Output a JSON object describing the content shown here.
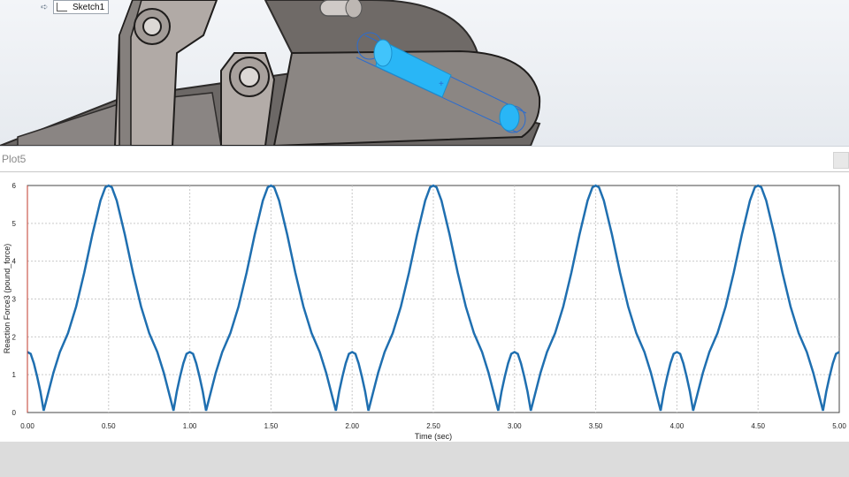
{
  "feature_tree": {
    "item_label": "Sketch1"
  },
  "plot": {
    "title": "Plot5",
    "close_icon": "close-icon"
  },
  "chart_data": {
    "type": "line",
    "xlabel": "Time (sec)",
    "ylabel": "Reaction Force3 (pound_force)",
    "xlim": [
      0,
      5
    ],
    "ylim": [
      0,
      6
    ],
    "grid": true,
    "series_color": "#1f6fb0",
    "x_ticks": [
      "0.00",
      "0.50",
      "1.00",
      "1.50",
      "2.00",
      "2.50",
      "3.00",
      "3.50",
      "4.00",
      "4.50",
      "5.00"
    ],
    "y_ticks": [
      "0",
      "1",
      "2",
      "3",
      "4",
      "5",
      "6"
    ],
    "series": [
      {
        "values": [
          [
            0.0,
            1.6
          ],
          [
            0.02,
            1.55
          ],
          [
            0.04,
            1.3
          ],
          [
            0.06,
            0.95
          ],
          [
            0.08,
            0.55
          ],
          [
            0.1,
            0.05
          ],
          [
            0.13,
            0.55
          ],
          [
            0.16,
            1.05
          ],
          [
            0.2,
            1.6
          ],
          [
            0.25,
            2.1
          ],
          [
            0.3,
            2.8
          ],
          [
            0.35,
            3.7
          ],
          [
            0.4,
            4.7
          ],
          [
            0.45,
            5.6
          ],
          [
            0.48,
            5.95
          ],
          [
            0.5,
            6.0
          ],
          [
            0.52,
            5.95
          ],
          [
            0.55,
            5.6
          ],
          [
            0.6,
            4.7
          ],
          [
            0.65,
            3.7
          ],
          [
            0.7,
            2.8
          ],
          [
            0.75,
            2.1
          ],
          [
            0.8,
            1.6
          ],
          [
            0.84,
            1.05
          ],
          [
            0.87,
            0.55
          ],
          [
            0.9,
            0.05
          ],
          [
            0.92,
            0.55
          ],
          [
            0.94,
            0.95
          ],
          [
            0.96,
            1.3
          ],
          [
            0.98,
            1.55
          ],
          [
            1.0,
            1.6
          ],
          [
            1.02,
            1.55
          ],
          [
            1.04,
            1.3
          ],
          [
            1.06,
            0.95
          ],
          [
            1.08,
            0.55
          ],
          [
            1.1,
            0.05
          ],
          [
            1.13,
            0.55
          ],
          [
            1.16,
            1.05
          ],
          [
            1.2,
            1.6
          ],
          [
            1.25,
            2.1
          ],
          [
            1.3,
            2.8
          ],
          [
            1.35,
            3.7
          ],
          [
            1.4,
            4.7
          ],
          [
            1.45,
            5.6
          ],
          [
            1.48,
            5.95
          ],
          [
            1.5,
            6.0
          ],
          [
            1.52,
            5.95
          ],
          [
            1.55,
            5.6
          ],
          [
            1.6,
            4.7
          ],
          [
            1.65,
            3.7
          ],
          [
            1.7,
            2.8
          ],
          [
            1.75,
            2.1
          ],
          [
            1.8,
            1.6
          ],
          [
            1.84,
            1.05
          ],
          [
            1.87,
            0.55
          ],
          [
            1.9,
            0.05
          ],
          [
            1.92,
            0.55
          ],
          [
            1.94,
            0.95
          ],
          [
            1.96,
            1.3
          ],
          [
            1.98,
            1.55
          ],
          [
            2.0,
            1.6
          ],
          [
            2.02,
            1.55
          ],
          [
            2.04,
            1.3
          ],
          [
            2.06,
            0.95
          ],
          [
            2.08,
            0.55
          ],
          [
            2.1,
            0.05
          ],
          [
            2.13,
            0.55
          ],
          [
            2.16,
            1.05
          ],
          [
            2.2,
            1.6
          ],
          [
            2.25,
            2.1
          ],
          [
            2.3,
            2.8
          ],
          [
            2.35,
            3.7
          ],
          [
            2.4,
            4.7
          ],
          [
            2.45,
            5.6
          ],
          [
            2.48,
            5.95
          ],
          [
            2.5,
            6.0
          ],
          [
            2.52,
            5.95
          ],
          [
            2.55,
            5.6
          ],
          [
            2.6,
            4.7
          ],
          [
            2.65,
            3.7
          ],
          [
            2.7,
            2.8
          ],
          [
            2.75,
            2.1
          ],
          [
            2.8,
            1.6
          ],
          [
            2.84,
            1.05
          ],
          [
            2.87,
            0.55
          ],
          [
            2.9,
            0.05
          ],
          [
            2.92,
            0.55
          ],
          [
            2.94,
            0.95
          ],
          [
            2.96,
            1.3
          ],
          [
            2.98,
            1.55
          ],
          [
            3.0,
            1.6
          ],
          [
            3.02,
            1.55
          ],
          [
            3.04,
            1.3
          ],
          [
            3.06,
            0.95
          ],
          [
            3.08,
            0.55
          ],
          [
            3.1,
            0.05
          ],
          [
            3.13,
            0.55
          ],
          [
            3.16,
            1.05
          ],
          [
            3.2,
            1.6
          ],
          [
            3.25,
            2.1
          ],
          [
            3.3,
            2.8
          ],
          [
            3.35,
            3.7
          ],
          [
            3.4,
            4.7
          ],
          [
            3.45,
            5.6
          ],
          [
            3.48,
            5.95
          ],
          [
            3.5,
            6.0
          ],
          [
            3.52,
            5.95
          ],
          [
            3.55,
            5.6
          ],
          [
            3.6,
            4.7
          ],
          [
            3.65,
            3.7
          ],
          [
            3.7,
            2.8
          ],
          [
            3.75,
            2.1
          ],
          [
            3.8,
            1.6
          ],
          [
            3.84,
            1.05
          ],
          [
            3.87,
            0.55
          ],
          [
            3.9,
            0.05
          ],
          [
            3.92,
            0.55
          ],
          [
            3.94,
            0.95
          ],
          [
            3.96,
            1.3
          ],
          [
            3.98,
            1.55
          ],
          [
            4.0,
            1.6
          ],
          [
            4.02,
            1.55
          ],
          [
            4.04,
            1.3
          ],
          [
            4.06,
            0.95
          ],
          [
            4.08,
            0.55
          ],
          [
            4.1,
            0.05
          ],
          [
            4.13,
            0.55
          ],
          [
            4.16,
            1.05
          ],
          [
            4.2,
            1.6
          ],
          [
            4.25,
            2.1
          ],
          [
            4.3,
            2.8
          ],
          [
            4.35,
            3.7
          ],
          [
            4.4,
            4.7
          ],
          [
            4.45,
            5.6
          ],
          [
            4.48,
            5.95
          ],
          [
            4.5,
            6.0
          ],
          [
            4.52,
            5.95
          ],
          [
            4.55,
            5.6
          ],
          [
            4.6,
            4.7
          ],
          [
            4.65,
            3.7
          ],
          [
            4.7,
            2.8
          ],
          [
            4.75,
            2.1
          ],
          [
            4.8,
            1.6
          ],
          [
            4.84,
            1.05
          ],
          [
            4.87,
            0.55
          ],
          [
            4.9,
            0.05
          ],
          [
            4.92,
            0.55
          ],
          [
            4.94,
            0.95
          ],
          [
            4.96,
            1.3
          ],
          [
            4.98,
            1.55
          ],
          [
            5.0,
            1.6
          ]
        ]
      }
    ]
  }
}
